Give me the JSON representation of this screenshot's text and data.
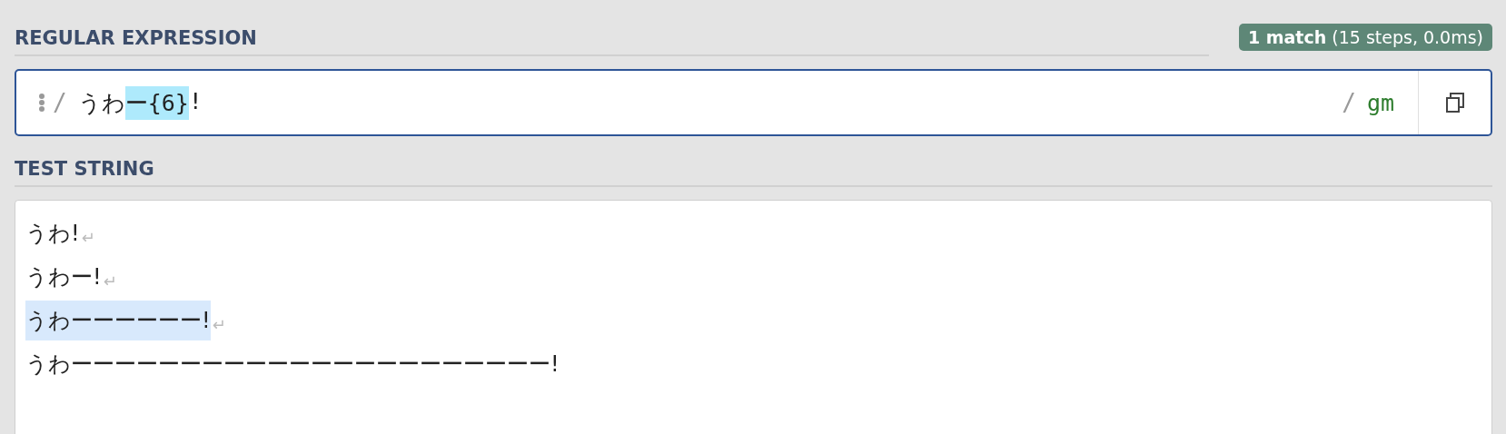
{
  "regex_section": {
    "title": "REGULAR EXPRESSION",
    "badge": "**1 match** (15 steps, 0.0ms)",
    "delimiter_open": "/",
    "tokens": [
      {
        "text": "うわ",
        "highlighted": false
      },
      {
        "text": "ー{6}",
        "highlighted": true
      },
      {
        "text": "!",
        "highlighted": false
      }
    ],
    "delimiter_close": "/",
    "flags": "gm"
  },
  "test_section": {
    "title": "TEST STRING",
    "lines": [
      {
        "text": "うわ!",
        "matched": false,
        "end_mark": "↵"
      },
      {
        "text": "うわー!",
        "matched": false,
        "end_mark": "↵"
      },
      {
        "text": "うわーーーーーー!",
        "matched": true,
        "end_mark": "↵"
      },
      {
        "text": "うわーーーーーーーーーーーーーーーーーーーーーー!",
        "matched": false
      }
    ]
  }
}
